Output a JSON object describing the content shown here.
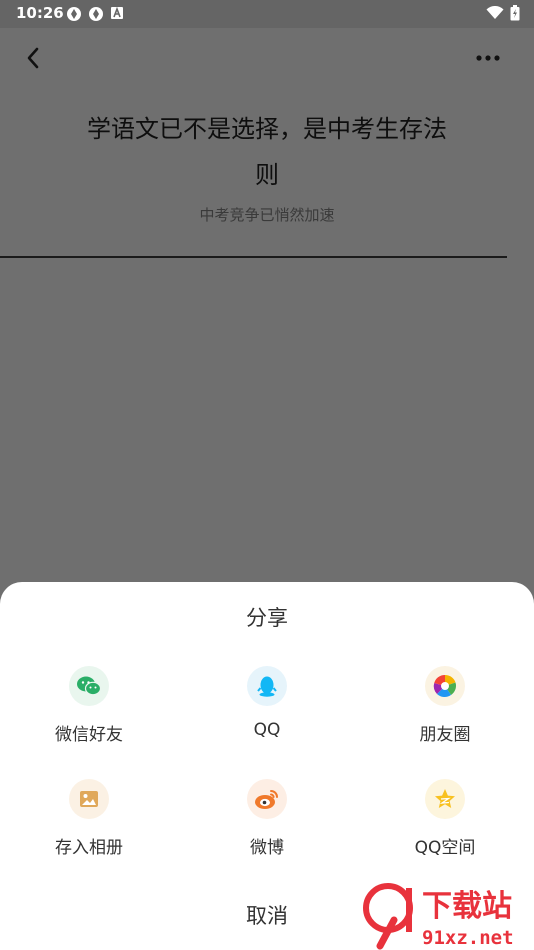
{
  "status_bar": {
    "time": "10:26",
    "left_icons": [
      "sync-icon",
      "sync-icon",
      "font-app-icon"
    ],
    "right_icons": [
      "wifi-icon",
      "battery-charging-icon"
    ]
  },
  "header": {
    "back_icon": "chevron-left-icon",
    "more_icon": "more-dots-icon"
  },
  "article": {
    "title": "学语文已不是选择，是中考生存法则",
    "subtitle": "中考竞争已悄然加速"
  },
  "share_sheet": {
    "title": "分享",
    "items": [
      {
        "label": "微信好友",
        "icon": "wechat-icon",
        "color": "#2aae67"
      },
      {
        "label": "QQ",
        "icon": "qq-icon",
        "color": "#12b7f5"
      },
      {
        "label": "朋友圈",
        "icon": "moments-icon",
        "color": "#f4b400"
      },
      {
        "label": "存入相册",
        "icon": "album-icon",
        "color": "#e0a85a"
      },
      {
        "label": "微博",
        "icon": "weibo-icon",
        "color": "#f0792b"
      },
      {
        "label": "QQ空间",
        "icon": "qzone-icon",
        "color": "#f8c120"
      }
    ],
    "cancel_label": "取消"
  },
  "watermark": {
    "line1": "下载站",
    "line2": "91xz.net"
  },
  "colors": {
    "dim_overlay": "#6f6f6f",
    "sheet_bg": "#ffffff",
    "watermark_red": "#e8323c"
  }
}
